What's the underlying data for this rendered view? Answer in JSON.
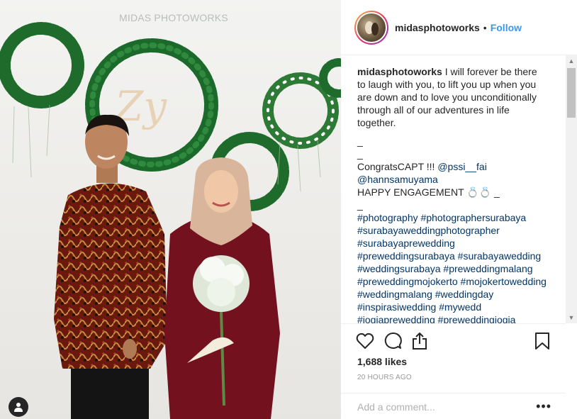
{
  "photo": {
    "watermark": "MIDAS PHOTOWORKS",
    "watermark_faint": "MIDAS PHOTOWORKS",
    "monogram": "Zy",
    "user_tag_icon": "person-icon"
  },
  "header": {
    "username": "midasphotoworks",
    "separator": "•",
    "follow_label": "Follow"
  },
  "caption": {
    "username": "midasphotoworks",
    "text": "I will forever be there to laugh with you, to lift you up when you are down and to love you unconditionally through all of our adventures in life together.",
    "sep1": "_",
    "sep2": "_",
    "congrats": "CongratsCAPT !!! ",
    "mention1": "@pssi__fai",
    "mention2": "@hannsamuyama",
    "engagement": "HAPPY ENGAGEMENT 💍💍 _",
    "sep3": "_",
    "hashtags": [
      "#photography",
      "#photographersurabaya",
      "#surabayaweddingphotographer",
      "#surabayaprewedding",
      "#preweddingsurabaya",
      "#surabayawedding",
      "#weddingsurabaya",
      "#preweddingmalang",
      "#preweddingmojokerto",
      "#mojokertowedding",
      "#weddingmalang",
      "#weddingday",
      "#inspirasiwedding",
      "#mywedd",
      "#jogjaprewedding",
      "#preweddingjogja"
    ]
  },
  "actions": {
    "like_icon": "heart-icon",
    "comment_icon": "speech-bubble-icon",
    "share_icon": "share-icon",
    "save_icon": "bookmark-icon"
  },
  "likes_text": "1,688 likes",
  "timestamp": "20 HOURS AGO",
  "comment": {
    "placeholder": "Add a comment...",
    "more_label": "•••"
  },
  "colors": {
    "link": "#3897f0",
    "hashtag": "#003569",
    "text": "#262626",
    "muted": "#999999"
  }
}
